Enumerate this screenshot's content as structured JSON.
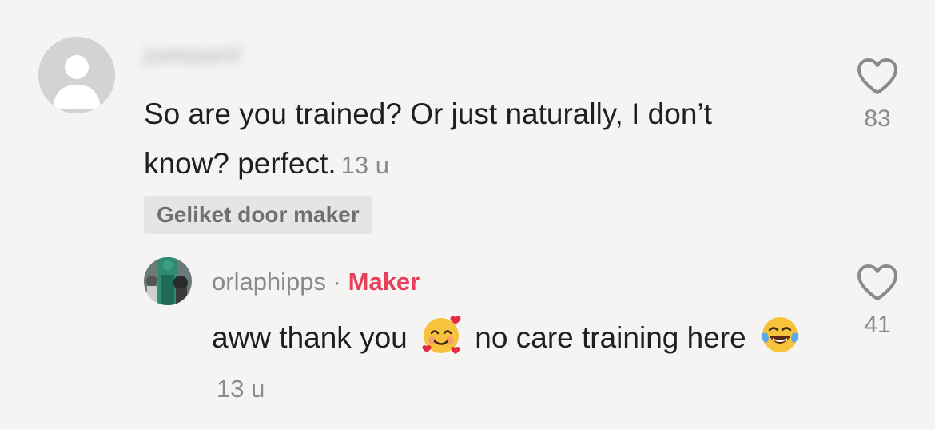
{
  "comment": {
    "username": "joeepanil",
    "text": "So are you trained? Or just naturally, I don’t know? perfect.",
    "timestamp": "13 u",
    "liked_by_creator_badge": "Geliket door maker",
    "like_count": "83",
    "avatar_icon": "default-user-icon"
  },
  "reply": {
    "username": "orlaphipps",
    "separator": "·",
    "role_badge": "Maker",
    "text_part1": "aww thank you",
    "emoji1": "smiling-face-with-hearts",
    "text_part2": "no care training here",
    "emoji2": "face-with-tears-of-joy",
    "timestamp": "13 u",
    "like_count": "41"
  },
  "colors": {
    "background": "#f5f4f2",
    "text": "#1f1f1f",
    "muted": "#8a8a8a",
    "maker_accent": "#e8405a",
    "badge_bg": "#e6e5e3"
  }
}
